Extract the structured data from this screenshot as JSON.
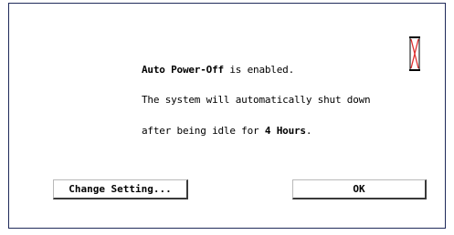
{
  "dialog": {
    "icon": "hourglass-icon",
    "line1_bold": "Auto Power-Off",
    "line1_rest": " is enabled.",
    "line2": "The system will automatically shut down",
    "line3_pre": "after being idle for ",
    "line3_bold": "4 Hours",
    "line3_post": "."
  },
  "buttons": {
    "change_setting": "Change Setting...",
    "ok": "OK"
  },
  "colors": {
    "frame": "#1f2a5a",
    "hourglass_stroke": "#000000",
    "hourglass_sand": "#e03030"
  }
}
